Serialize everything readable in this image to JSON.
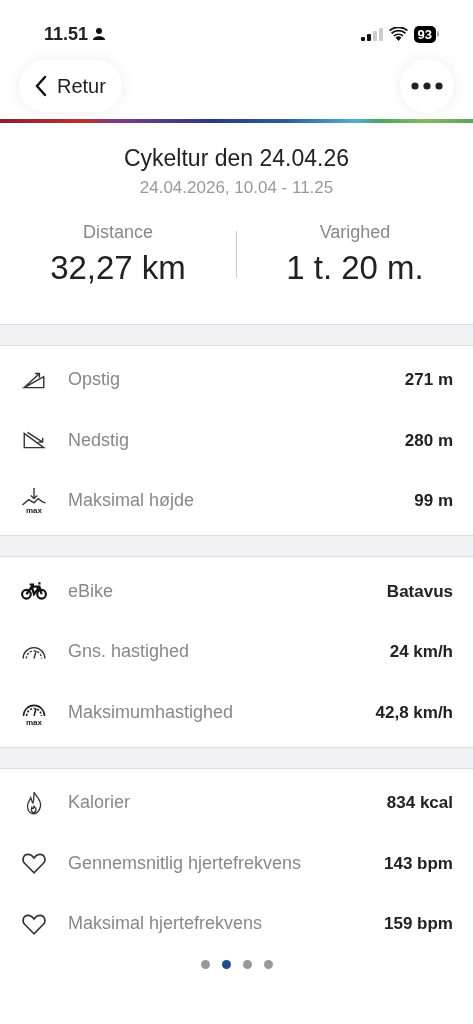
{
  "status_bar": {
    "time": "11.51",
    "battery": "93"
  },
  "nav": {
    "back_label": "Retur"
  },
  "header": {
    "title": "Cykeltur den 24.04.26",
    "subtitle": "24.04.2026, 10.04 - 11.25"
  },
  "stats": [
    {
      "label": "Distance",
      "value": "32,27 km"
    },
    {
      "label": "Varighed",
      "value": "1 t. 20 m."
    }
  ],
  "sections": [
    {
      "rows": [
        {
          "kind": "ascent",
          "label": "Opstig",
          "value": "271 m"
        },
        {
          "kind": "descent",
          "label": "Nedstig",
          "value": "280 m"
        },
        {
          "kind": "altitude",
          "icon_label": "max",
          "label": "Maksimal højde",
          "value": "99 m"
        }
      ]
    },
    {
      "rows": [
        {
          "kind": "bike",
          "label": "eBike",
          "value": "Batavus"
        },
        {
          "kind": "speed",
          "label": "Gns. hastighed",
          "value": "24 km/h"
        },
        {
          "kind": "topspeed",
          "icon_label": "max",
          "label": "Maksimumhastighed",
          "value": "42,8 km/h"
        }
      ]
    },
    {
      "rows": [
        {
          "kind": "calories",
          "label": "Kalorier",
          "value": "834 kcal"
        },
        {
          "kind": "heartrate",
          "label": "Gennemsnitlig hjertefrekvens",
          "value": "143 bpm"
        },
        {
          "kind": "heartrate",
          "label": "Maksimal hjertefrekvens",
          "value": "159 bpm"
        }
      ]
    }
  ],
  "pages": [
    {
      "selected": false
    },
    {
      "selected": true
    },
    {
      "selected": false
    },
    {
      "selected": false
    }
  ]
}
